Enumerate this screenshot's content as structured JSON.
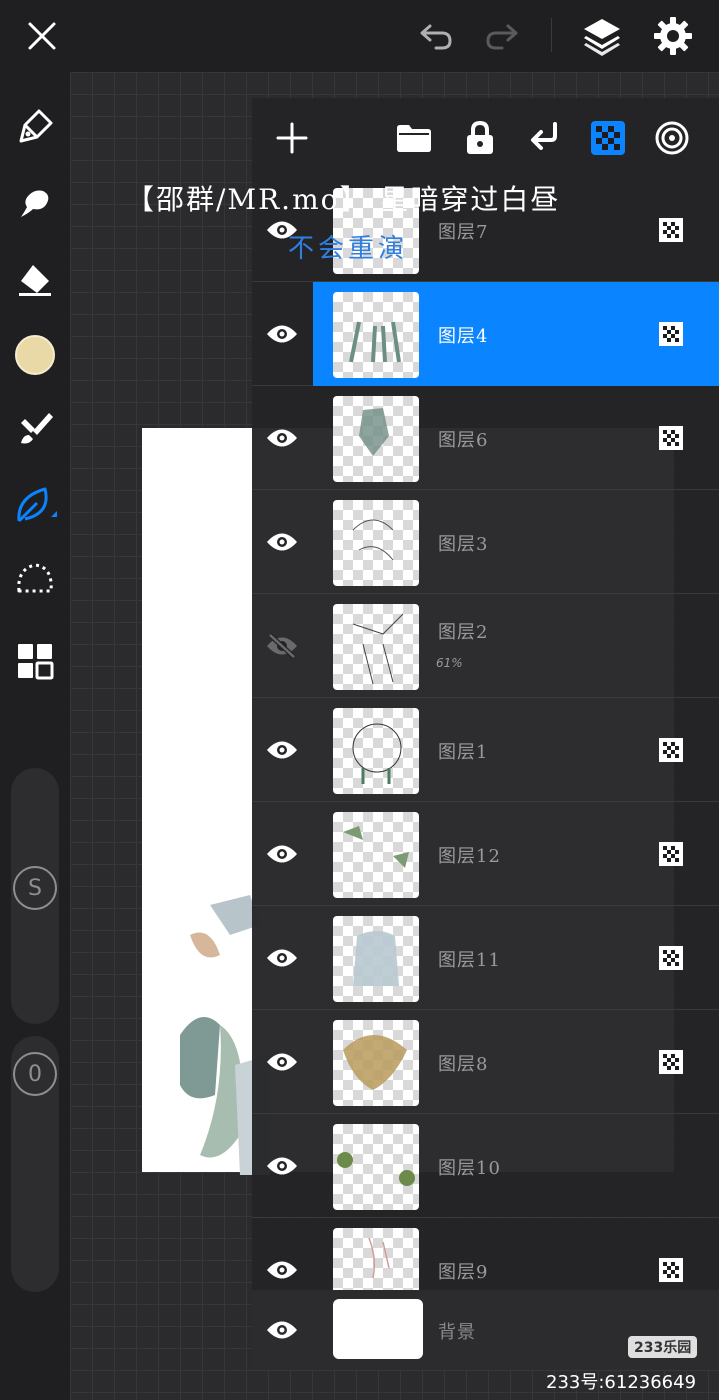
{
  "overlay": {
    "title": "【邵群/MR.mo】 星暗穿过白昼",
    "subtitle": "不会重演"
  },
  "topbar": {
    "icons": [
      "close-icon",
      "undo-icon",
      "redo-icon",
      "layers-icon",
      "gear-icon"
    ]
  },
  "left_toolbar": {
    "tools": [
      "pencil-icon",
      "smudge-icon",
      "eraser-icon",
      "color-swatch",
      "brush-icon",
      "leaf-brush-icon",
      "lasso-icon",
      "grid-icon"
    ],
    "selected_tool": "leaf-brush-icon",
    "color_swatch": "#e9d9a6",
    "size_knob_label": "S",
    "opacity_knob_label": "0"
  },
  "layers_panel": {
    "toolbar_icons": [
      "add-icon",
      "folder-icon",
      "lock-icon",
      "merge-down-icon",
      "alpha-lock-icon",
      "reference-icon"
    ],
    "accent": "#0a84ff",
    "layers": [
      {
        "name": "图层7",
        "visible": true,
        "alpha_lock": true,
        "selected": false
      },
      {
        "name": "图层4",
        "visible": true,
        "alpha_lock": true,
        "selected": true
      },
      {
        "name": "图层6",
        "visible": true,
        "alpha_lock": true,
        "selected": false
      },
      {
        "name": "图层3",
        "visible": true,
        "alpha_lock": false,
        "selected": false
      },
      {
        "name": "图层2",
        "visible": false,
        "alpha_lock": false,
        "selected": false,
        "opacity": "61%"
      },
      {
        "name": "图层1",
        "visible": true,
        "alpha_lock": true,
        "selected": false
      },
      {
        "name": "图层12",
        "visible": true,
        "alpha_lock": true,
        "selected": false
      },
      {
        "name": "图层11",
        "visible": true,
        "alpha_lock": true,
        "selected": false
      },
      {
        "name": "图层8",
        "visible": true,
        "alpha_lock": true,
        "selected": false
      },
      {
        "name": "图层10",
        "visible": true,
        "alpha_lock": false,
        "selected": false
      },
      {
        "name": "图层9",
        "visible": true,
        "alpha_lock": true,
        "selected": false
      }
    ],
    "background": {
      "name": "背景",
      "visible": true
    }
  },
  "watermark": {
    "logo": "233乐园",
    "id_text": "233号:61236649"
  }
}
